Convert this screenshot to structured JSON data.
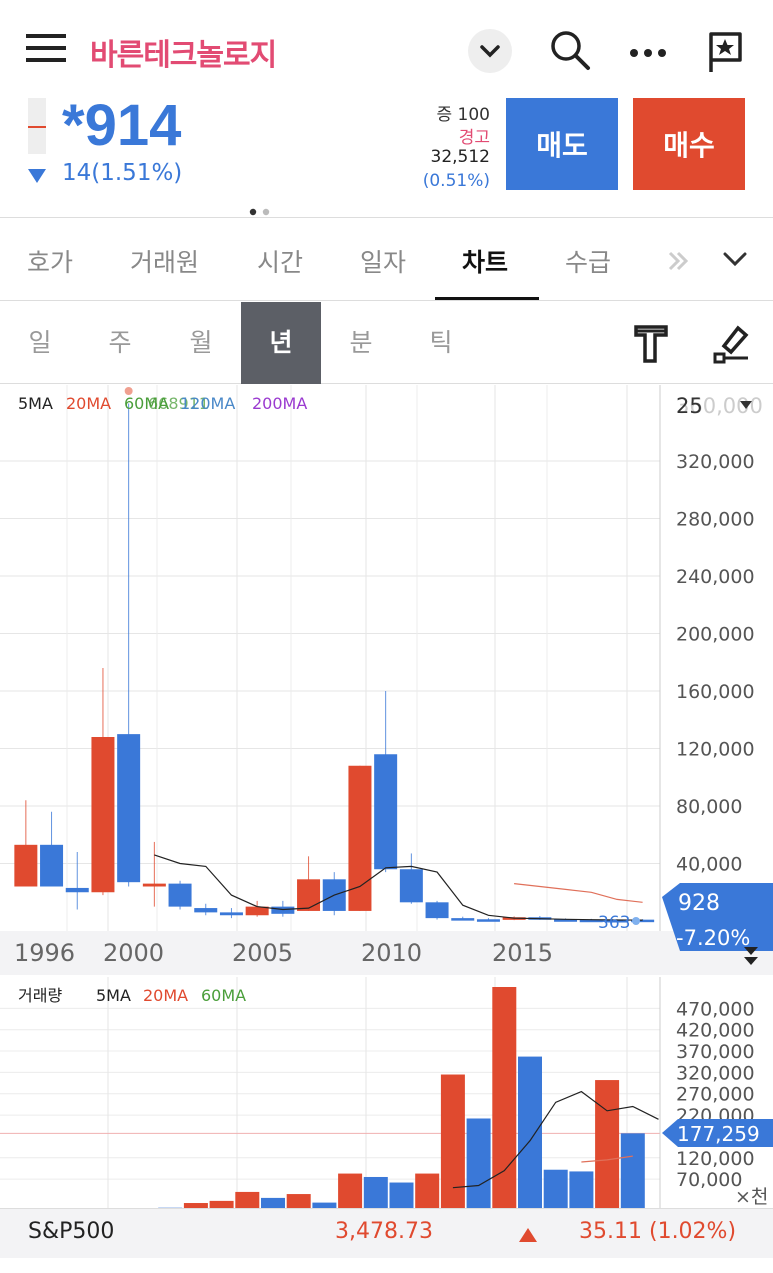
{
  "header": {
    "title": "바른테크놀로지",
    "menu_icon": "hamburger-icon",
    "dropdown_icon": "chevron-down-icon",
    "search_icon": "search-icon",
    "more_icon": "more-dots-icon",
    "flag_icon": "bookmark-flag-icon"
  },
  "quote": {
    "price": "*914",
    "change": "14(1.51%)",
    "tag1_label": "증",
    "tag1_value": "100",
    "warning": "경고",
    "volume": "32,512",
    "volume_pct": "(0.51%)",
    "sell_label": "매도",
    "buy_label": "매수"
  },
  "tabs": [
    "호가",
    "거래원",
    "시간",
    "일자",
    "차트",
    "수급"
  ],
  "periods": [
    "일",
    "주",
    "월",
    "년",
    "분",
    "틱"
  ],
  "colors": {
    "up": "#e04a2f",
    "down": "#3a78d8",
    "accent": "#e24b73"
  },
  "chart_data": [
    {
      "type": "candlestick",
      "legend": [
        "5MA",
        "20MA",
        "60MA",
        "120MA",
        "200MA"
      ],
      "legend_overlay": "668911",
      "x_ticks": [
        "1996",
        "2000",
        "2005",
        "2010",
        "2015"
      ],
      "y_ticks": [
        "320,000",
        "280,000",
        "240,000",
        "200,000",
        "160,000",
        "120,000",
        "80,000",
        "40,000"
      ],
      "y_top_label": "25",
      "y_top_label_faded": "360,000",
      "ylim": [
        0,
        370000
      ],
      "current_price": "928",
      "current_change": "-7.20%",
      "min_label": "363",
      "candles": [
        {
          "year": 1995,
          "open": 24000,
          "close": 53000,
          "high": 84000,
          "low": 24000,
          "dir": "up"
        },
        {
          "year": 1996,
          "open": 53000,
          "close": 24000,
          "high": 76000,
          "low": 24000,
          "dir": "down"
        },
        {
          "year": 1997,
          "open": 23000,
          "close": 20000,
          "high": 48000,
          "low": 8000,
          "dir": "down"
        },
        {
          "year": 1998,
          "open": 20000,
          "close": 128000,
          "high": 176000,
          "low": 18000,
          "dir": "up"
        },
        {
          "year": 1999,
          "open": 130000,
          "close": 27000,
          "high": 360000,
          "low": 24000,
          "dir": "down"
        },
        {
          "year": 2000,
          "open": 24000,
          "close": 26000,
          "high": 55000,
          "low": 10000,
          "dir": "up"
        },
        {
          "year": 2001,
          "open": 26000,
          "close": 10000,
          "high": 28000,
          "low": 8000,
          "dir": "down"
        },
        {
          "year": 2002,
          "open": 9000,
          "close": 6000,
          "high": 12000,
          "low": 4000,
          "dir": "down"
        },
        {
          "year": 2003,
          "open": 6000,
          "close": 4000,
          "high": 9000,
          "low": 2000,
          "dir": "down"
        },
        {
          "year": 2004,
          "open": 4000,
          "close": 10000,
          "high": 14000,
          "low": 3000,
          "dir": "up"
        },
        {
          "year": 2005,
          "open": 10000,
          "close": 5000,
          "high": 14000,
          "low": 3000,
          "dir": "down"
        },
        {
          "year": 2006,
          "open": 7000,
          "close": 29000,
          "high": 45000,
          "low": 7000,
          "dir": "up"
        },
        {
          "year": 2007,
          "open": 29000,
          "close": 7000,
          "high": 34000,
          "low": 4000,
          "dir": "down"
        },
        {
          "year": 2008,
          "open": 7000,
          "close": 108000,
          "high": 108000,
          "low": 7000,
          "dir": "up"
        },
        {
          "year": 2009,
          "open": 116000,
          "close": 36000,
          "high": 160000,
          "low": 34000,
          "dir": "down"
        },
        {
          "year": 2010,
          "open": 36000,
          "close": 13000,
          "high": 47000,
          "low": 12000,
          "dir": "down"
        },
        {
          "year": 2011,
          "open": 13000,
          "close": 2000,
          "high": 14000,
          "low": 1000,
          "dir": "down"
        },
        {
          "year": 2012,
          "open": 2000,
          "close": 1200,
          "high": 3000,
          "low": 800,
          "dir": "down"
        },
        {
          "year": 2013,
          "open": 1200,
          "close": 800,
          "high": 2000,
          "low": 500,
          "dir": "down"
        },
        {
          "year": 2014,
          "open": 800,
          "close": 2600,
          "high": 3200,
          "low": 600,
          "dir": "up"
        },
        {
          "year": 2015,
          "open": 2600,
          "close": 1200,
          "high": 3500,
          "low": 800,
          "dir": "down"
        },
        {
          "year": 2016,
          "open": 1200,
          "close": 900,
          "high": 1800,
          "low": 500,
          "dir": "down"
        },
        {
          "year": 2017,
          "open": 900,
          "close": 700,
          "high": 1500,
          "low": 400,
          "dir": "down"
        },
        {
          "year": 2018,
          "open": 700,
          "close": 500,
          "high": 1200,
          "low": 363,
          "dir": "down"
        },
        {
          "year": 2019,
          "open": 500,
          "close": 928,
          "high": 1300,
          "low": 363,
          "dir": "down"
        }
      ],
      "ma5": [
        [
          2000,
          46000
        ],
        [
          2001,
          40000
        ],
        [
          2002,
          38000
        ],
        [
          2003,
          18000
        ],
        [
          2004,
          10000
        ],
        [
          2005,
          8000
        ],
        [
          2006,
          9000
        ],
        [
          2007,
          18000
        ],
        [
          2008,
          24000
        ],
        [
          2009,
          37000
        ],
        [
          2010,
          38000
        ],
        [
          2011,
          34000
        ],
        [
          2012,
          11000
        ],
        [
          2013,
          4000
        ],
        [
          2014,
          2000
        ],
        [
          2015,
          1600
        ],
        [
          2016,
          1200
        ],
        [
          2017,
          900
        ],
        [
          2018,
          700
        ],
        [
          2019,
          600
        ]
      ],
      "ma20": [
        [
          2014,
          26000
        ],
        [
          2015,
          24000
        ],
        [
          2016,
          22000
        ],
        [
          2017,
          20000
        ],
        [
          2018,
          15000
        ],
        [
          2019,
          13000
        ]
      ]
    },
    {
      "type": "bar",
      "title": "거래량",
      "legend": [
        "5MA",
        "20MA",
        "60MA"
      ],
      "y_ticks": [
        "470,000",
        "420,000",
        "370,000",
        "320,000",
        "270,000",
        "220,000",
        "120,000",
        "70,000"
      ],
      "unit_label": "×천",
      "current_volume": "177,259",
      "ylim": [
        0,
        520000
      ],
      "values": [
        2000,
        2000,
        2000,
        2000,
        2000,
        2000,
        3000,
        14000,
        19000,
        40000,
        26000,
        35000,
        15000,
        83000,
        75000,
        62000,
        83000,
        315000,
        212000,
        520000,
        357000,
        92000,
        88000,
        302000,
        177259
      ],
      "dirs": [
        "up",
        "down",
        "down",
        "up",
        "down",
        "up",
        "down",
        "up",
        "up",
        "up",
        "down",
        "up",
        "down",
        "up",
        "down",
        "down",
        "up",
        "up",
        "down",
        "up",
        "down",
        "down",
        "down",
        "up",
        "down"
      ],
      "ma5": [
        [
          2012,
          50000
        ],
        [
          2013,
          55000
        ],
        [
          2014,
          90000
        ],
        [
          2015,
          160000
        ],
        [
          2016,
          250000
        ],
        [
          2017,
          275000
        ],
        [
          2018,
          230000
        ],
        [
          2019,
          240000
        ],
        [
          2020,
          210000
        ]
      ],
      "ma20": [
        [
          2017,
          110000
        ],
        [
          2018,
          115000
        ],
        [
          2019,
          124000
        ]
      ]
    }
  ],
  "footer": {
    "index_name": "S&P500",
    "index_value": "3,478.73",
    "index_change": "35.11",
    "index_change_pct": "(1.02%)"
  }
}
